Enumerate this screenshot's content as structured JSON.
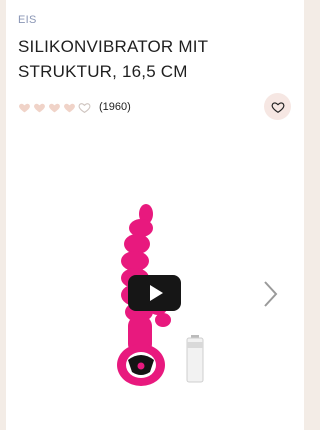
{
  "product": {
    "brand": "EIS",
    "title": "SILIKONVIBRATOR MIT STRUKTUR, 16,5 CM"
  },
  "rating": {
    "value": 4,
    "max": 5,
    "count_label": "(1960)",
    "heart_color": "#f0d3c8",
    "heart_empty_color": "#cfc5c0"
  },
  "wishlist": {
    "icon": "heart-outline-icon",
    "bg_color": "#f6e7e3"
  },
  "media": {
    "play_icon": "play-icon",
    "next_icon": "chevron-right-icon",
    "product_color": "#e8197e"
  }
}
